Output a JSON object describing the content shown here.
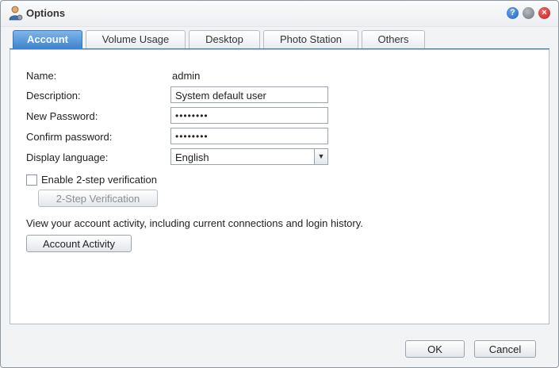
{
  "window": {
    "title": "Options",
    "icon": "user-options-icon"
  },
  "titlebar_buttons": [
    {
      "name": "help",
      "glyph": "?"
    },
    {
      "name": "minimize",
      "glyph": ""
    },
    {
      "name": "close",
      "glyph": "×"
    }
  ],
  "tabs": [
    {
      "label": "Account",
      "active": true
    },
    {
      "label": "Volume Usage",
      "active": false
    },
    {
      "label": "Desktop",
      "active": false
    },
    {
      "label": "Photo Station",
      "active": false
    },
    {
      "label": "Others",
      "active": false
    }
  ],
  "form": {
    "name_label": "Name:",
    "name_value": "admin",
    "description_label": "Description:",
    "description_value": "System default user",
    "new_password_label": "New Password:",
    "new_password_value": "••••••••",
    "confirm_password_label": "Confirm password:",
    "confirm_password_value": "••••••••",
    "language_label": "Display language:",
    "language_value": "English"
  },
  "two_step": {
    "checkbox_label": "Enable 2-step verification",
    "checked": false,
    "button_label": "2-Step Verification"
  },
  "activity": {
    "info_text": "View your account activity, including current connections and login history.",
    "button_label": "Account Activity"
  },
  "footer": {
    "ok_label": "OK",
    "cancel_label": "Cancel"
  },
  "colors": {
    "accent": "#3b82cc",
    "window_bg": "#f2f3f5",
    "panel_border": "#b4bcc6"
  }
}
